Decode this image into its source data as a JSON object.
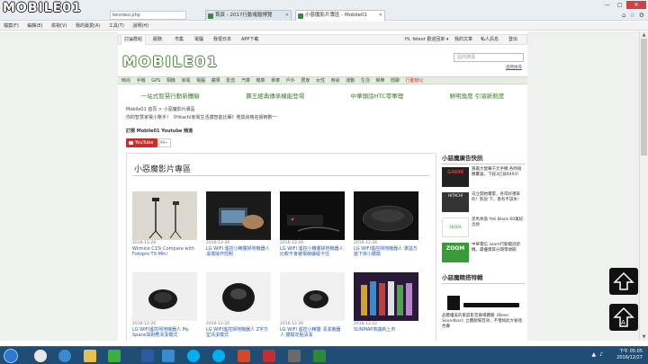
{
  "browser": {
    "logo_text": "MOBILE01",
    "address": "bevideo.php",
    "tabs": [
      {
        "label": "首頁 - 2017行動電腦博覽",
        "active": false
      },
      {
        "label": "小惡魔影片專區 - Mobile01",
        "active": true
      }
    ],
    "menu": [
      "檔案(F)",
      "編輯(E)",
      "檢視(V)",
      "我的最愛(A)",
      "工具(T)",
      "說明(H)"
    ],
    "window_controls": {
      "minimize": "—",
      "maximize": "□",
      "close": "✕"
    }
  },
  "site": {
    "topnav": [
      "討論群組",
      "服務",
      "市集",
      "電腦",
      "我很日本",
      "APP下載"
    ],
    "user_links": [
      "Hi, feleor 歡迎回來 ▾",
      "我的文章",
      "私人訊息",
      "登出"
    ],
    "logo": "MOBILE01",
    "search_placeholder": "站內搜尋",
    "search_link": "進階搜尋",
    "categories": [
      "時尚",
      "手機",
      "GPS",
      "相機",
      "家電",
      "電腦",
      "蘋果",
      "影音",
      "汽車",
      "機車",
      "單車",
      "戶外",
      "居家",
      "女性",
      "時尚",
      "運動",
      "生活",
      "娛樂",
      "閒聊"
    ],
    "category_highlight": "行動辦公",
    "promos": [
      "一站式智慧行動新體驗",
      "賽王經典傳承機能登場",
      "中華頭話HTC零軍理",
      "鮮明角度 引領新館度"
    ],
    "breadcrumb": "Mobile01 首頁 > 小惡魔影片專區",
    "notice": "你的智慧家電小幫手！《Hitachi家電生活讚智能比賽》贈獎資格名額倒數一",
    "subscribe_label": "訂閱 Mobile01 Youtube 頻道",
    "youtube_label": "YouTube",
    "youtube_count": "99+"
  },
  "videos": {
    "heading": "小惡魔影片專區",
    "items": [
      {
        "date": "2016-12-28",
        "title": "Wiimice C15i Compare with Fotopro TX-Mini"
      },
      {
        "date": "2016-12-26",
        "title": "LG WIFI 遙控小精靈掃地機器人 遠端操作控制"
      },
      {
        "date": "2016-12-26",
        "title": "LG WIFI 遙控小精靈掃地機器人 比較不會被電線纏繞卡住"
      },
      {
        "date": "2016-12-26",
        "title": "LG WIFI遙控掃地機器人 滿溢方盤下拆小體驗"
      },
      {
        "date": "2016-12-26",
        "title": "LG WIFI遙控掃地機器人 My Space與對應清潔模式"
      },
      {
        "date": "2016-12-26",
        "title": "LG WIFI遙控掃地機器人 Z字方型清潔模式"
      },
      {
        "date": "2016-12-26",
        "title": "LG WIFI 遙控小精靈 清潔機器人 體驗定點清潔"
      },
      {
        "date": "2016-12-22",
        "title": "SUNMAP商議新上市"
      }
    ]
  },
  "sidebar": {
    "ads_heading": "小惡魔廣告快訊",
    "ads": [
      {
        "brand": "G4600",
        "text": "買最大螢幕千元手機 各時搶機驚喜，下殺3亿就8493！"
      },
      {
        "brand": "HITACHI",
        "text": "日立開始積累，各得好禮來的！對說 下，香有不該失！"
      },
      {
        "brand": "ŠKODA",
        "text": "黑馬休旅 Yeti Black 60萬紀念款"
      },
      {
        "brand": "ZOOM",
        "text": "中華電信 zoom行動電話新機，最優資質分期零頭期"
      }
    ],
    "live_heading": "小惡魔精搭特輯",
    "live_text": "品聽優美的家庭影音劇場體驗《Bose Soundbar》立體劇場音效，不僅如此大秘境色籌"
  },
  "taskbar": {
    "time": "下午 05:05",
    "date": "2016/12/27"
  },
  "colors": {
    "brand_green": "#4a7a3a",
    "youtube_red": "#c4302b",
    "taskbar_blue": "#1f4d73"
  }
}
